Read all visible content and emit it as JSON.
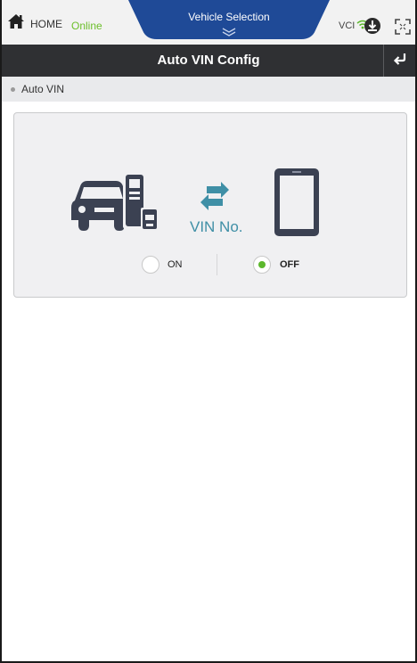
{
  "status_bar": {
    "home_label": "HOME",
    "online_label": "Online",
    "vehicle_selection_label": "Vehicle Selection",
    "vci_label": "VCI",
    "icons": [
      "home-icon",
      "chevron-down-icon",
      "wifi-icon",
      "download-icon",
      "fullscreen-icon"
    ]
  },
  "header": {
    "title": "Auto VIN Config",
    "back_icon": "back-arrow-icon"
  },
  "breadcrumb": {
    "label": "Auto VIN"
  },
  "auto_vin_card": {
    "vin_label": "VIN No.",
    "options": [
      {
        "label": "ON",
        "selected": false
      },
      {
        "label": "OFF",
        "selected": true
      }
    ],
    "icons": [
      "car-scanner-icon",
      "sync-icon",
      "tablet-icon"
    ]
  },
  "colors": {
    "title_bar": "#2f3033",
    "tab_blue": "#1f4a97",
    "online_green": "#6cbf2b",
    "radio_selected": "#5cb82c",
    "icon_dark": "#3b4152",
    "sync_teal": "#3f8fa6"
  }
}
